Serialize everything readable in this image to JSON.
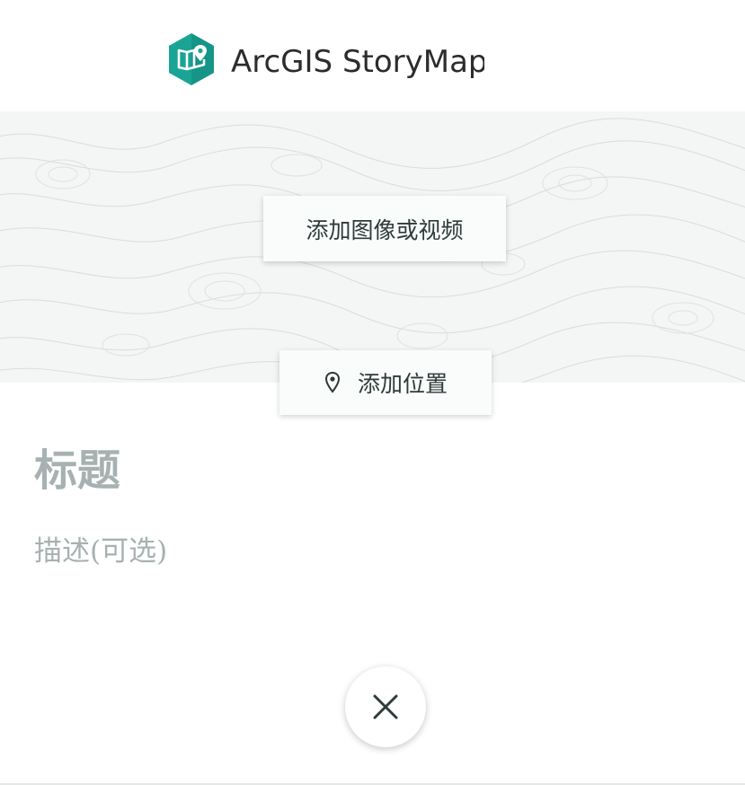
{
  "header": {
    "brand_name": "ArcGIS StoryMaps",
    "logo_icon": "storymaps-logo-icon",
    "brand_color": "#1aa495"
  },
  "cover": {
    "background_pattern": "topographic-contour-pattern",
    "add_media_label": "添加图像或视频",
    "add_location_label": "添加位置",
    "location_icon": "map-pin-icon"
  },
  "story": {
    "title_placeholder": "标题",
    "description_placeholder": "描述(可选)"
  },
  "actions": {
    "close_icon": "close-icon"
  },
  "colors": {
    "placeholder_text": "#a7b1b1",
    "button_text": "#2f3a3a",
    "cover_background": "#f4f5f5"
  }
}
